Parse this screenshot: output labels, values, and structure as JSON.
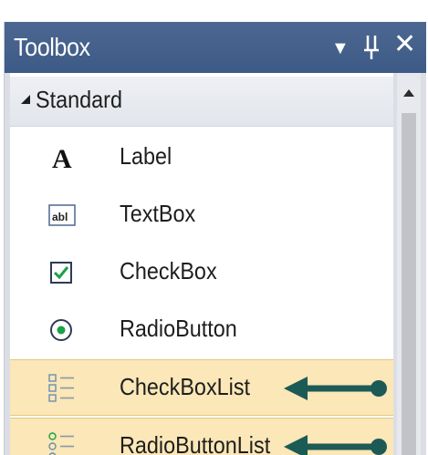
{
  "toolbox": {
    "title": "Toolbox",
    "icons": {
      "dropdown": "▼",
      "pin": "⊥",
      "close": "✕"
    },
    "group": {
      "label": "Standard"
    },
    "items": [
      {
        "label": "Label",
        "icon": "label-icon",
        "highlighted": false
      },
      {
        "label": "TextBox",
        "icon": "textbox-icon",
        "highlighted": false
      },
      {
        "label": "CheckBox",
        "icon": "checkbox-icon",
        "highlighted": false
      },
      {
        "label": "RadioButton",
        "icon": "radiobutton-icon",
        "highlighted": false
      },
      {
        "label": "CheckBoxList",
        "icon": "checkboxlist-icon",
        "highlighted": true
      },
      {
        "label": "RadioButtonList",
        "icon": "radiobuttonlist-icon",
        "highlighted": true
      }
    ],
    "colors": {
      "titlebar": "#3d5a86",
      "highlight": "#fbe7b7",
      "arrow": "#1c5a56"
    },
    "label_icon_glyph": "A",
    "textbox_icon_text": "abl"
  }
}
